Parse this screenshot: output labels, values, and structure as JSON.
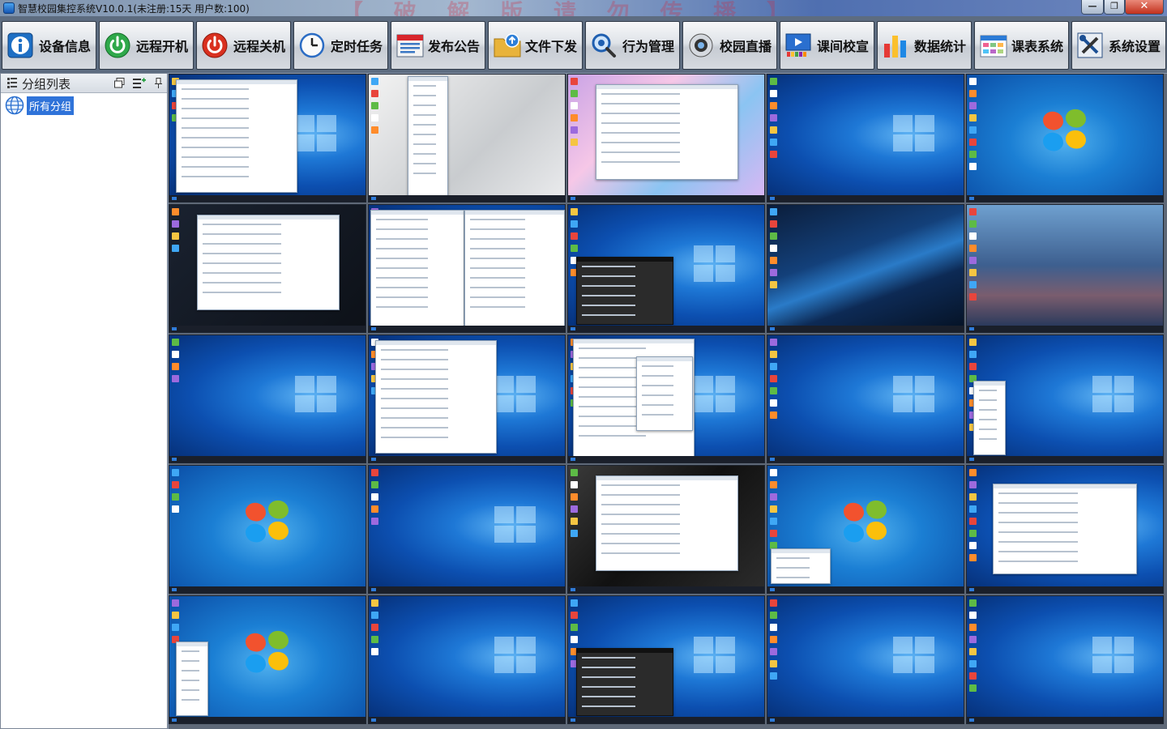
{
  "window": {
    "title": "智慧校园集控系统V10.0.1(未注册:15天 用户数:100)",
    "watermark": "【 破 解 版 请 勿 传 播 】"
  },
  "toolbar": {
    "items": [
      {
        "id": "device-info",
        "label": "设备信息",
        "icon": "info-icon"
      },
      {
        "id": "remote-boot",
        "label": "远程开机",
        "icon": "power-on-icon"
      },
      {
        "id": "remote-shutdown",
        "label": "远程关机",
        "icon": "power-off-icon"
      },
      {
        "id": "scheduled-task",
        "label": "定时任务",
        "icon": "clock-icon"
      },
      {
        "id": "announcement",
        "label": "发布公告",
        "icon": "notice-icon"
      },
      {
        "id": "file-distribution",
        "label": "文件下发",
        "icon": "folder-upload-icon"
      },
      {
        "id": "behavior-management",
        "label": "行为管理",
        "icon": "magnifier-icon"
      },
      {
        "id": "campus-live",
        "label": "校园直播",
        "icon": "camera-icon"
      },
      {
        "id": "break-broadcast",
        "label": "课间校宣",
        "icon": "media-player-icon"
      },
      {
        "id": "statistics",
        "label": "数据统计",
        "icon": "bar-chart-icon"
      },
      {
        "id": "timetable",
        "label": "课表系统",
        "icon": "calendar-grid-icon"
      },
      {
        "id": "settings",
        "label": "系统设置",
        "icon": "tools-icon"
      }
    ]
  },
  "sidebar": {
    "title": "分组列表",
    "groups": [
      {
        "label": "所有分组",
        "icon": "globe-icon",
        "selected": true
      }
    ]
  },
  "colors": {
    "selection": "#2f73d9",
    "toolbar_bg": "#5d6c80",
    "close_button": "#c2301c"
  },
  "thumbnails": [
    {
      "theme": "w10",
      "window": "settings"
    },
    {
      "theme": "snow",
      "window": "start-menu"
    },
    {
      "theme": "flow",
      "window": "dialog"
    },
    {
      "theme": "w10",
      "window": "none"
    },
    {
      "theme": "w7",
      "window": "icons"
    },
    {
      "theme": "dark",
      "window": "dialog"
    },
    {
      "theme": "w10",
      "window": "explorer"
    },
    {
      "theme": "w10",
      "window": "start-tiles"
    },
    {
      "theme": "wave",
      "window": "none"
    },
    {
      "theme": "blur",
      "window": "none"
    },
    {
      "theme": "w10",
      "window": "none"
    },
    {
      "theme": "w10",
      "window": "settings"
    },
    {
      "theme": "w10",
      "window": "device-manager"
    },
    {
      "theme": "w10",
      "window": "none"
    },
    {
      "theme": "w10",
      "window": "context-menu"
    },
    {
      "theme": "w7",
      "window": "none"
    },
    {
      "theme": "w10",
      "window": "none"
    },
    {
      "theme": "gothic",
      "window": "dialog"
    },
    {
      "theme": "w7",
      "window": "small-dialog"
    },
    {
      "theme": "w10",
      "window": "installer"
    },
    {
      "theme": "w7",
      "window": "context-menu"
    },
    {
      "theme": "w10",
      "window": "none"
    },
    {
      "theme": "w10",
      "window": "start-tiles"
    },
    {
      "theme": "w10",
      "window": "none"
    },
    {
      "theme": "w10",
      "window": "none"
    }
  ]
}
